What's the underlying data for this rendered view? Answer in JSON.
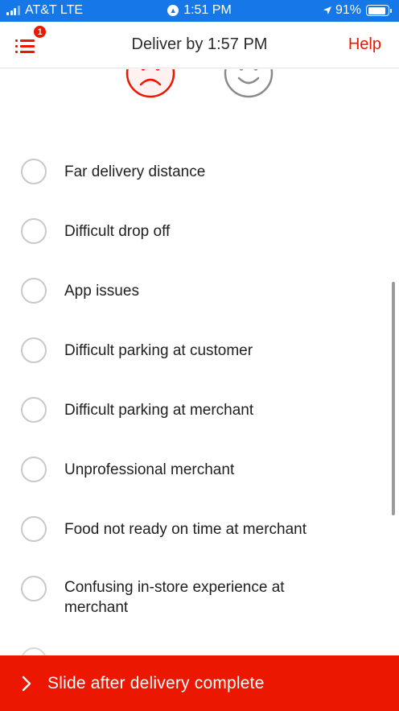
{
  "status_bar": {
    "carrier": "AT&T LTE",
    "time": "1:51 PM",
    "battery": "91%",
    "battery_level": 0.91,
    "icons": [
      "signal-icon",
      "navigation-icon",
      "location-arrow-icon",
      "battery-icon"
    ]
  },
  "header": {
    "title": "Deliver by 1:57 PM",
    "help_label": "Help",
    "menu_badge_count": "1",
    "menu_icon": "list-icon"
  },
  "feedback": {
    "selected_face": "sad",
    "faces": [
      "sad-face-icon",
      "happy-face-icon"
    ]
  },
  "reasons": [
    {
      "label": "Far delivery distance",
      "checked": false
    },
    {
      "label": "Difficult drop off",
      "checked": false
    },
    {
      "label": "App issues",
      "checked": false
    },
    {
      "label": "Difficult parking at customer",
      "checked": false
    },
    {
      "label": "Difficult parking at merchant",
      "checked": false
    },
    {
      "label": "Unprofessional merchant",
      "checked": false
    },
    {
      "label": "Food not ready on time at merchant",
      "checked": false
    },
    {
      "label": "Confusing in-store experience at merchant",
      "checked": false
    }
  ],
  "slide_action": {
    "label": "Slide after delivery complete",
    "icon": "chevron-right-icon"
  },
  "colors": {
    "brand_red": "#eb1700",
    "status_bar_blue": "#1677e8",
    "radio_border": "#c9c9c9",
    "happy_face_gray": "#8a8a8a"
  }
}
